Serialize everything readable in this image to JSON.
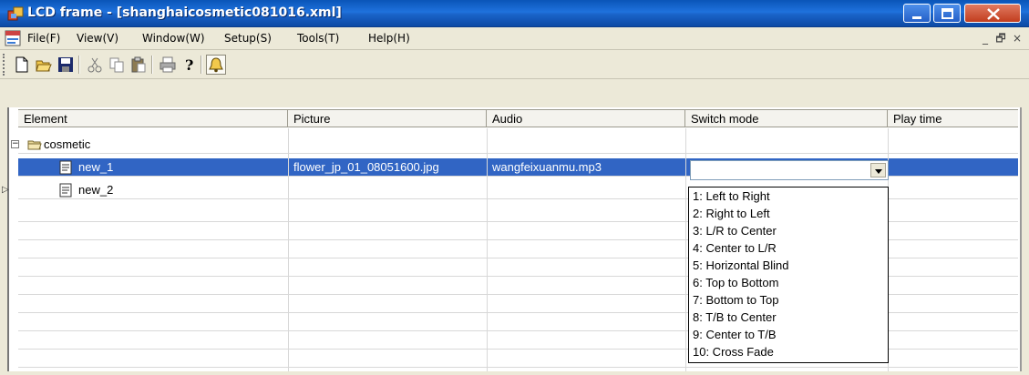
{
  "window": {
    "title": "LCD frame - [shanghaicosmetic081016.xml]"
  },
  "menu": {
    "items": [
      "File(F)",
      "View(V)",
      "Window(W)",
      "Setup(S)",
      "Tools(T)",
      "Help(H)"
    ],
    "mdi_minimize": "_",
    "mdi_restore": "🗗",
    "mdi_close": "×"
  },
  "toolbar": {
    "buttons": [
      "new-icon",
      "open-icon",
      "save-icon",
      "cut-icon",
      "copy-icon",
      "paste-icon",
      "print-icon",
      "help-icon",
      "bell-icon"
    ]
  },
  "grid": {
    "columns": [
      "Element",
      "Picture",
      "Audio",
      "Switch mode",
      "Play time"
    ],
    "rows": [
      {
        "element": "cosmetic",
        "picture": "",
        "audio": "",
        "switch_mode": "",
        "play_time": "",
        "type": "folder"
      },
      {
        "element": "new_1",
        "picture": "flower_jp_01_08051600.jpg",
        "audio": "wangfeixuanmu.mp3",
        "switch_mode": "",
        "play_time": "",
        "type": "item",
        "selected": true
      },
      {
        "element": "new_2",
        "picture": "",
        "audio": "",
        "switch_mode": "",
        "play_time": "",
        "type": "item"
      }
    ],
    "expander_symbol": "−",
    "row_marker": "▷"
  },
  "switch_mode_dropdown": {
    "value": "",
    "options": [
      "1: Left to Right",
      "2: Right to Left",
      "3: L/R to Center",
      "4: Center to L/R",
      "5: Horizontal Blind",
      "6: Top to Bottom",
      "7: Bottom to Top",
      "8: T/B to Center",
      "9: Center to T/B",
      "10: Cross Fade"
    ]
  },
  "colors": {
    "titlebar": "#1f72dd",
    "selection": "#3165c4",
    "chrome": "#ece9d8"
  }
}
